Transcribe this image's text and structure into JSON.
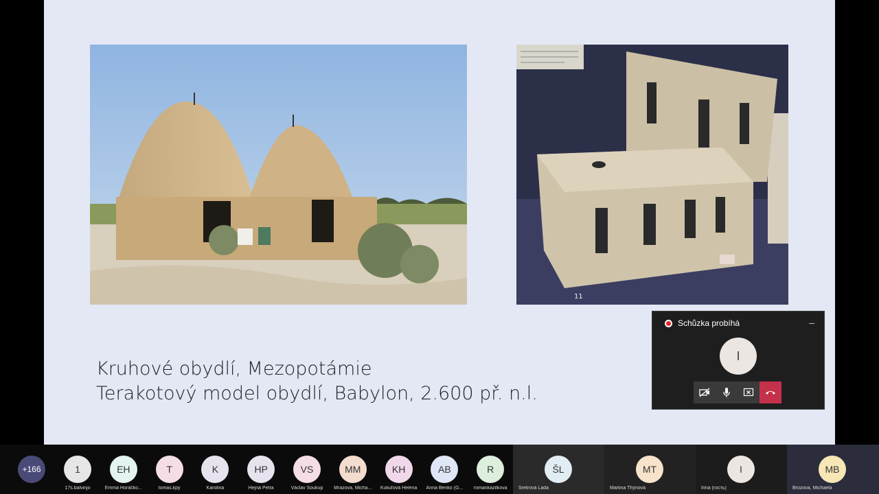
{
  "caption": {
    "line1": "Kruhové obydlí, Mezopotámie",
    "line2": "Terakotový model obydlí, Babylon, 2.600 př. n.l."
  },
  "model_photo": {
    "number_label": "11"
  },
  "meeting": {
    "status": "Schůzka probíhá",
    "avatar_initial": "I",
    "minimize_label": "–"
  },
  "participants": {
    "more_count": "+166",
    "list": [
      {
        "initials": "1",
        "name": "17s.balvinjo",
        "color": "#e6e6e6"
      },
      {
        "initials": "EH",
        "name": "Emma Horáčko...",
        "color": "#e3f3f0"
      },
      {
        "initials": "T",
        "name": "tomas.kpy",
        "color": "#f5dde5"
      },
      {
        "initials": "K",
        "name": "Karolina",
        "color": "#e6e3ef"
      },
      {
        "initials": "HP",
        "name": "Hejná Petra",
        "color": "#e6e3ef"
      },
      {
        "initials": "VS",
        "name": "Václav Soukup",
        "color": "#f5dde5"
      },
      {
        "initials": "MM",
        "name": "Mrazova, Micha...",
        "color": "#f3dccd"
      },
      {
        "initials": "KH",
        "name": "Kukuľová Helena",
        "color": "#f0d8ea"
      },
      {
        "initials": "AB",
        "name": "Anna Benko (G...",
        "color": "#dfe6f5"
      },
      {
        "initials": "R",
        "name": "romankazilkova",
        "color": "#ddeedd"
      }
    ],
    "wide": [
      {
        "initials": "ŠL",
        "name": "Šretrová Lada",
        "color": "#e2ecf3"
      },
      {
        "initials": "MT",
        "name": "Martina Thýnová",
        "color": "#f7e3cc"
      },
      {
        "initials": "I",
        "name": "Irina (гость)",
        "color": "#ece6e2"
      },
      {
        "initials": "MB",
        "name": "Brozova, Michaela",
        "color": "#f7e6b6"
      }
    ]
  }
}
